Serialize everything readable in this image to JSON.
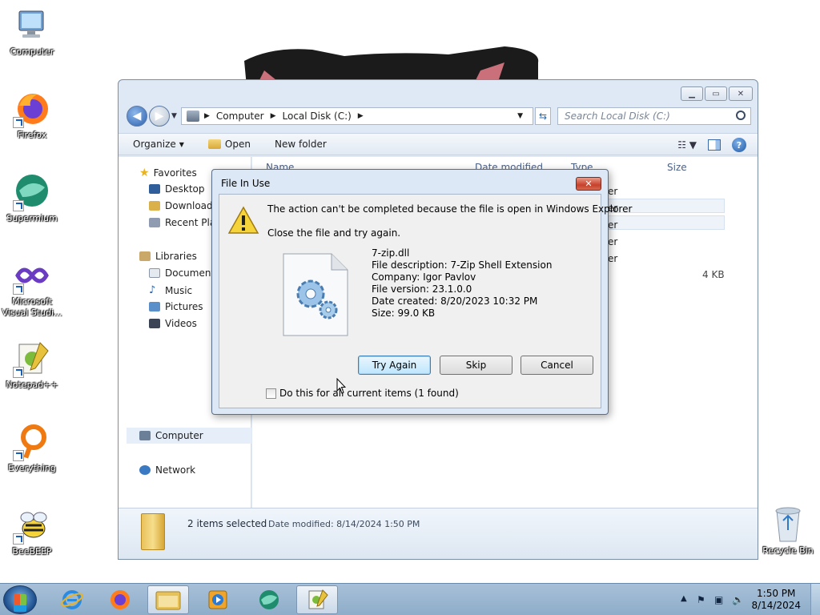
{
  "desktop": {
    "icons": [
      {
        "label": "Computer",
        "icon": "computer-icon"
      },
      {
        "label": "Firefox",
        "icon": "firefox-icon"
      },
      {
        "label": "Supermium",
        "icon": "supermium-icon"
      },
      {
        "label": "Microsoft Visual Studi...",
        "icon": "visual-studio-icon"
      },
      {
        "label": "Notepad++",
        "icon": "notepadpp-icon"
      },
      {
        "label": "Everything",
        "icon": "everything-icon"
      },
      {
        "label": "BeeBEEP",
        "icon": "beebeep-icon"
      }
    ],
    "recycle_bin": "Recycle Bin"
  },
  "explorer": {
    "breadcrumb": [
      "Computer",
      "Local Disk (C:)"
    ],
    "search_placeholder": "Search Local Disk (C:)",
    "toolbar": {
      "organize": "Organize",
      "open": "Open",
      "new_folder": "New folder"
    },
    "nav": {
      "favorites": "Favorites",
      "desktop": "Desktop",
      "downloads": "Downloads",
      "recent": "Recent Plac",
      "libraries": "Libraries",
      "documents": "Documents",
      "music": "Music",
      "pictures": "Pictures",
      "videos": "Videos",
      "computer": "Computer",
      "network": "Network"
    },
    "columns": {
      "name": "Name",
      "date": "Date modified",
      "type": "Type",
      "size": "Size"
    },
    "type_cells": [
      "er",
      "er",
      "er",
      "er",
      "er"
    ],
    "size_cell": "4 KB",
    "status": {
      "selected": "2 items selected",
      "modified_label": "Date modified:",
      "modified_value": "8/14/2024 1:50 PM"
    }
  },
  "dialog": {
    "title": "File In Use",
    "close": "✕",
    "message": "The action can't be completed because the file is open in Windows Explorer",
    "instruction": "Close the file and try again.",
    "file": {
      "name": "7-zip.dll",
      "description": "File description: 7-Zip Shell Extension",
      "company": "Company: Igor Pavlov",
      "version": "File version: 23.1.0.0",
      "created": "Date created: 8/20/2023 10:32 PM",
      "size": "Size: 99.0 KB"
    },
    "buttons": {
      "try_again": "Try Again",
      "skip": "Skip",
      "cancel": "Cancel"
    },
    "checkbox": "Do this for all current items (1 found)"
  },
  "taskbar": {
    "clock_time": "1:50 PM",
    "clock_date": "8/14/2024"
  },
  "colors": {
    "accent": "#1f5aa6",
    "close_red": "#c7412a"
  }
}
